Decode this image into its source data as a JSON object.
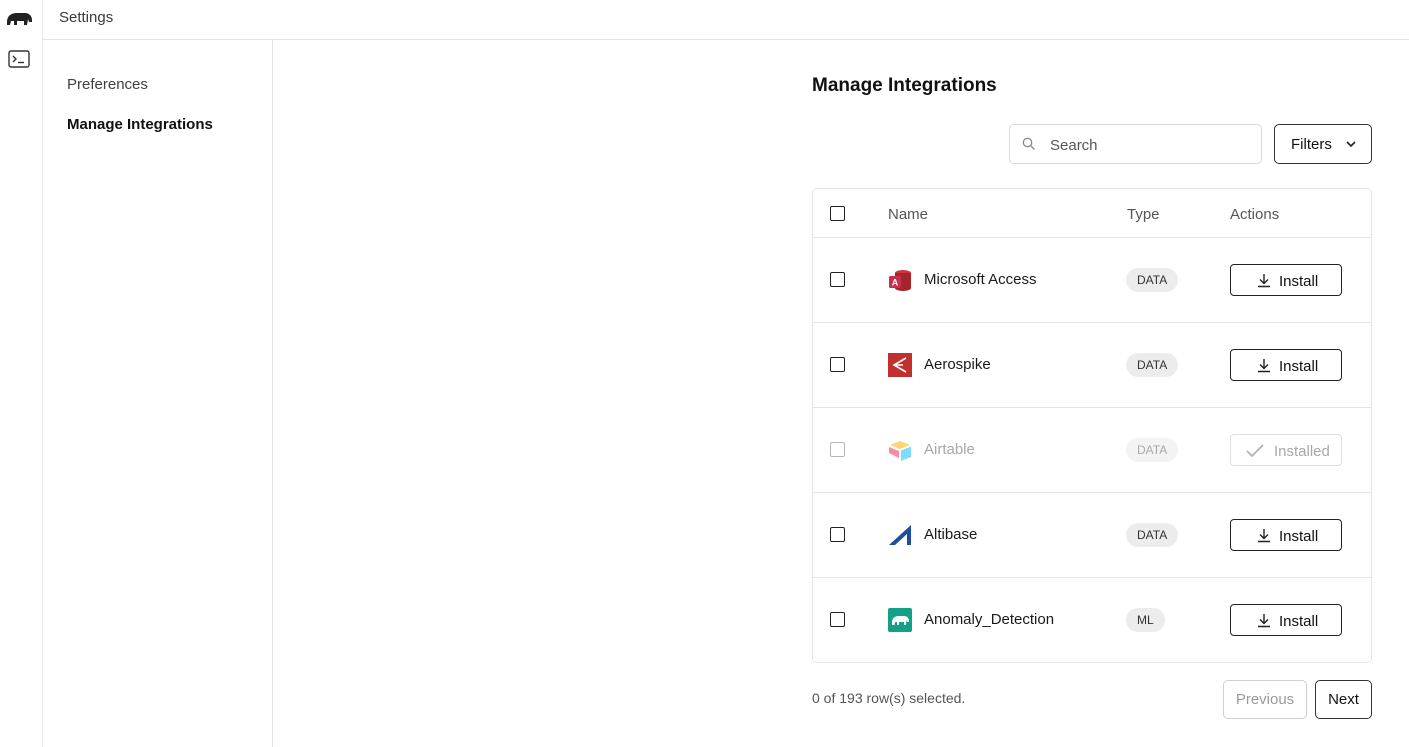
{
  "topbar": {
    "title": "Settings"
  },
  "nav": {
    "items": [
      {
        "label": "Preferences"
      },
      {
        "label": "Manage Integrations"
      }
    ]
  },
  "main": {
    "heading": "Manage Integrations",
    "search": {
      "placeholder": "Search",
      "value": ""
    },
    "filters_label": "Filters"
  },
  "table": {
    "columns": {
      "name": "Name",
      "type": "Type",
      "actions": "Actions"
    },
    "rows": [
      {
        "name": "Microsoft Access",
        "type": "DATA",
        "action": "Install",
        "icon": "microsoft-access-icon",
        "disabled": false
      },
      {
        "name": "Aerospike",
        "type": "DATA",
        "action": "Install",
        "icon": "aerospike-icon",
        "disabled": false
      },
      {
        "name": "Airtable",
        "type": "DATA",
        "action": "Installed",
        "icon": "airtable-icon",
        "disabled": true
      },
      {
        "name": "Altibase",
        "type": "DATA",
        "action": "Install",
        "icon": "altibase-icon",
        "disabled": false
      },
      {
        "name": "Anomaly_Detection",
        "type": "ML",
        "action": "Install",
        "icon": "anomaly-detection-icon",
        "disabled": false
      }
    ]
  },
  "footer": {
    "selection_text": "0 of 193 row(s) selected.",
    "previous_label": "Previous",
    "next_label": "Next"
  },
  "colors": {
    "access_red": "#a4262c",
    "aerospike_red": "#c22f2f",
    "altibase_blue": "#1f4e9c",
    "anomaly_teal": "#14a085"
  }
}
